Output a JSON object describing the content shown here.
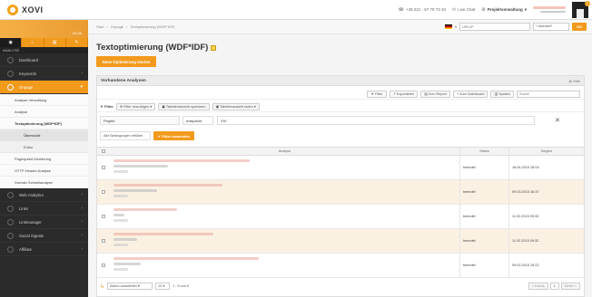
{
  "brand": {
    "name": "XOVI"
  },
  "topbar": {
    "phone": "+49 221 - 67 79 73 40",
    "chat": "Live Chat",
    "project_menu": "Projektverwaltung",
    "user_name": "",
    "avatar_badge": "1"
  },
  "sidebar": {
    "balance": "61,00",
    "section_label": "ANALYSE",
    "nav": [
      {
        "label": "Dashboard"
      },
      {
        "label": "Keywords"
      },
      {
        "label": "Onpage"
      }
    ],
    "onpage_sub": [
      {
        "label": "Analyse-Verwaltung"
      },
      {
        "label": "Analyse"
      },
      {
        "label": "Textoptimierung (WDF*IDF)"
      }
    ],
    "wdf_sub": [
      {
        "label": "Übersicht"
      },
      {
        "label": "Editor"
      }
    ],
    "tools": [
      {
        "label": "Pagespeed Monitoring"
      },
      {
        "label": "HTTP-Header Analyse"
      },
      {
        "label": "Domain Schnellanalyse"
      }
    ],
    "nav_bottom": [
      {
        "label": "Web Analytics"
      },
      {
        "label": "Links"
      },
      {
        "label": "Linkmanager"
      },
      {
        "label": "Social Signals"
      },
      {
        "label": "Affiliate"
      }
    ]
  },
  "breadcrumb": [
    "Start",
    "Onpage",
    "Textoptimierung (WDF*IDF)"
  ],
  "crumbbar": {
    "url_placeholder": "URL/IP",
    "domain_select": "*.domain/*",
    "go": "GO"
  },
  "page": {
    "title": "Textoptimierung (WDF*IDF)",
    "new_button": "Neue Optimierung starten"
  },
  "panel": {
    "title": "Vorhandene Analysen",
    "help": "Hilfe",
    "toolbar": {
      "filter": "Filter",
      "export": "Exportieren",
      "report": "Zum Report",
      "dashboard": "Zum Dashboard",
      "columns": "Spalten",
      "search_placeholder": "Suche"
    },
    "filterbar": {
      "label": "Filter",
      "add": "Filter hinzufügen",
      "save_view": "Tabellenansicht speichern",
      "load_view": "Tabellenansicht laden"
    },
    "filter_row": {
      "field": "Projekt",
      "operator": "entspricht",
      "value": "XVI"
    },
    "conditions": {
      "select": "Alle Bedingungen erfüllen",
      "apply": "Filter anwenden"
    },
    "table": {
      "columns": [
        "Analyse",
        "Status",
        "Beginn"
      ],
      "rows": [
        {
          "status": "beendet",
          "date": "16.04.2015 18:04"
        },
        {
          "status": "beendet",
          "date": "09.03.2015 16:37"
        },
        {
          "status": "beendet",
          "date": "11.02.2015 09:33"
        },
        {
          "status": "beendet",
          "date": "11.02.2015 09:32"
        },
        {
          "status": "beendet",
          "date": "09.02.2015 15:22"
        }
      ]
    },
    "footer": {
      "bulk_select": "Aktion auswählen",
      "per_page": "10",
      "range": "1 - 5 von 5",
      "prev": "« Zurück",
      "page": "1",
      "next": "Weiter »"
    }
  }
}
